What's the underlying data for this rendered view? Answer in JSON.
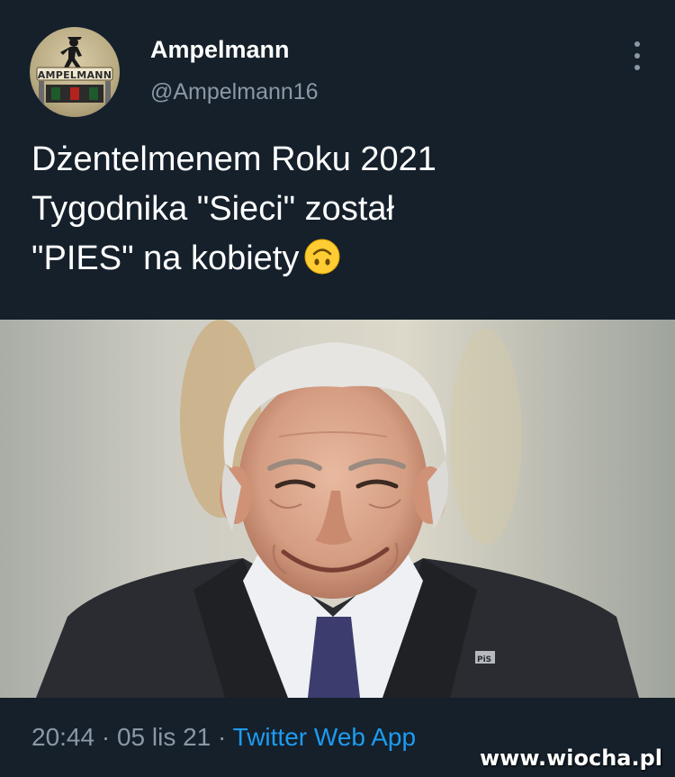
{
  "author": {
    "display_name": "Ampelmann",
    "handle": "@Ampelmann16",
    "avatar_label": "AMPELMANN",
    "avatar_icon": "ampelmann-traffic-light-figure"
  },
  "tweet": {
    "lines": [
      "Dżentelmenem Roku 2021",
      "Tygodnika \"Sieci\" został",
      "\"PIES\" na kobiety"
    ],
    "emoji": "upside-down-face"
  },
  "photo": {
    "subject": "elderly-man-smiling-portrait",
    "pin_text": "PiS"
  },
  "footer": {
    "time": "20:44",
    "separator": "·",
    "date": "05 lis 21",
    "app": "Twitter Web App"
  },
  "watermark": "www.wiocha.pl",
  "colors": {
    "background": "#15202b",
    "secondary_text": "#8b98a5",
    "link": "#1d9bf0"
  }
}
